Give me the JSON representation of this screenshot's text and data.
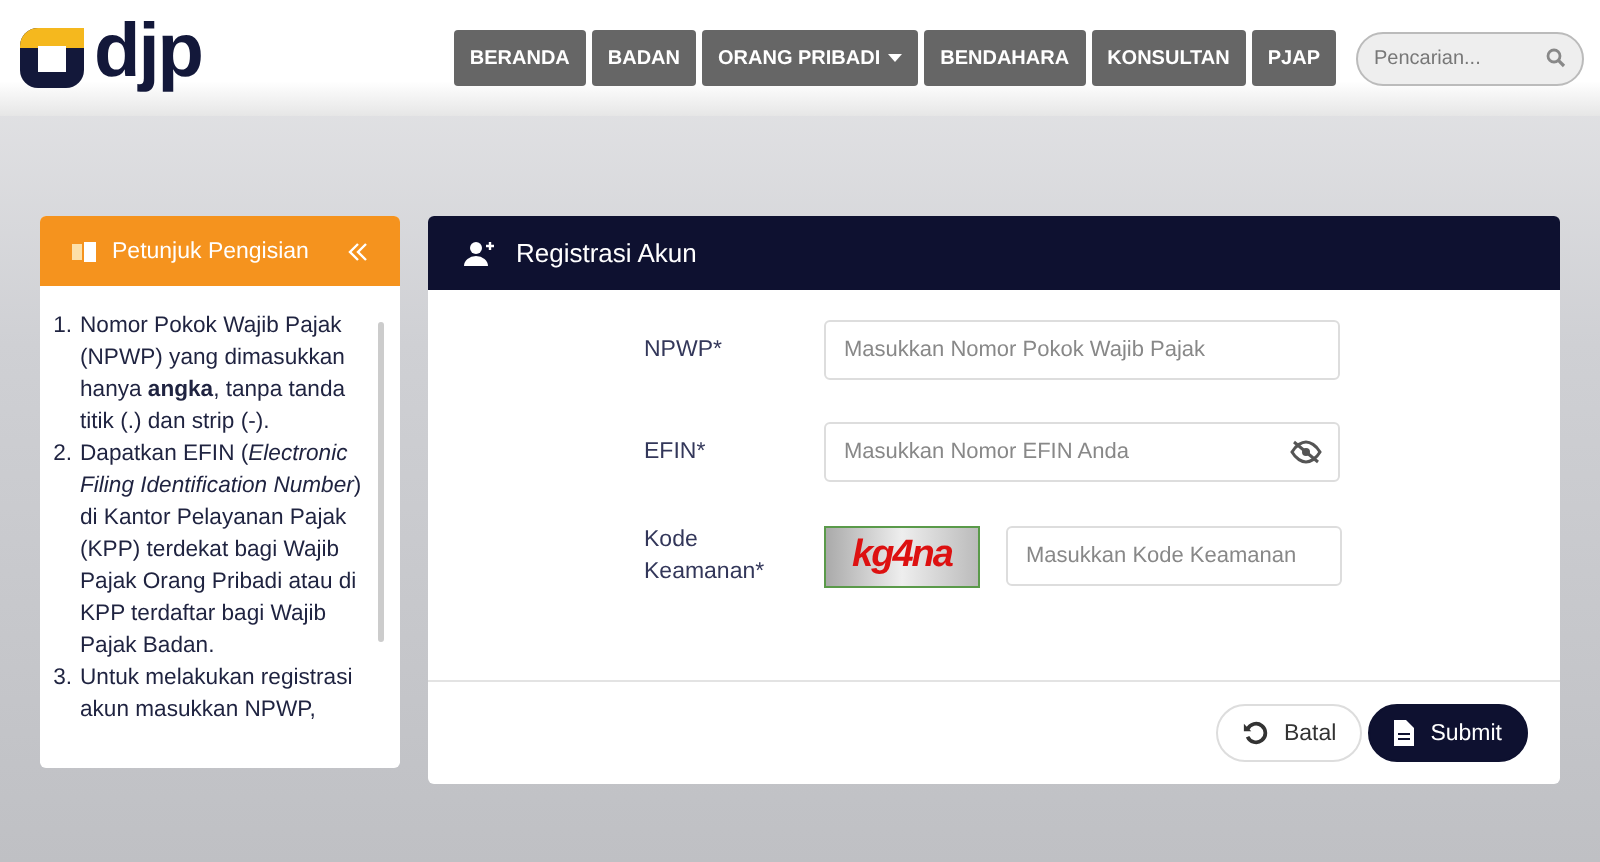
{
  "header": {
    "logo": "djp",
    "nav": [
      {
        "label": "BERANDA",
        "dropdown": false
      },
      {
        "label": "BADAN",
        "dropdown": false
      },
      {
        "label": "ORANG PRIBADI",
        "dropdown": true
      },
      {
        "label": "BENDAHARA",
        "dropdown": false
      },
      {
        "label": "KONSULTAN",
        "dropdown": false
      },
      {
        "label": "PJAP",
        "dropdown": false
      }
    ],
    "search": {
      "placeholder": "Pencarian..."
    }
  },
  "guide": {
    "title": "Petunjuk Pengisian",
    "items": [
      {
        "number": "1.",
        "text": "Nomor Pokok Wajib Pajak (NPWP) yang dimasukkan hanya **angka**, tanpa tanda titik (.) dan strip (-)."
      },
      {
        "number": "2.",
        "text": "Dapatkan EFIN (*Electronic Filing Identification Number*) di Kantor Pelayanan Pajak (KPP) terdekat bagi Wajib Pajak Orang Pribadi atau di KPP terdaftar bagi Wajib Pajak Badan."
      },
      {
        "number": "3.",
        "text": "Untuk melakukan registrasi akun masukkan NPWP,"
      }
    ]
  },
  "form": {
    "title": "Registrasi Akun",
    "fields": [
      {
        "kind": "text",
        "label": "NPWP*",
        "placeholder": "Masukkan Nomor Pokok Wajib Pajak"
      },
      {
        "kind": "password",
        "label": "EFIN*",
        "placeholder": "Masukkan Nomor EFIN Anda"
      },
      {
        "kind": "captcha",
        "label": "Kode Keamanan*",
        "captcha": "kg4na",
        "placeholder": "Masukkan Kode Keamanan"
      }
    ],
    "buttons": [
      {
        "kind": "reset",
        "label": "Batal"
      },
      {
        "kind": "submit",
        "label": "Submit"
      }
    ]
  }
}
